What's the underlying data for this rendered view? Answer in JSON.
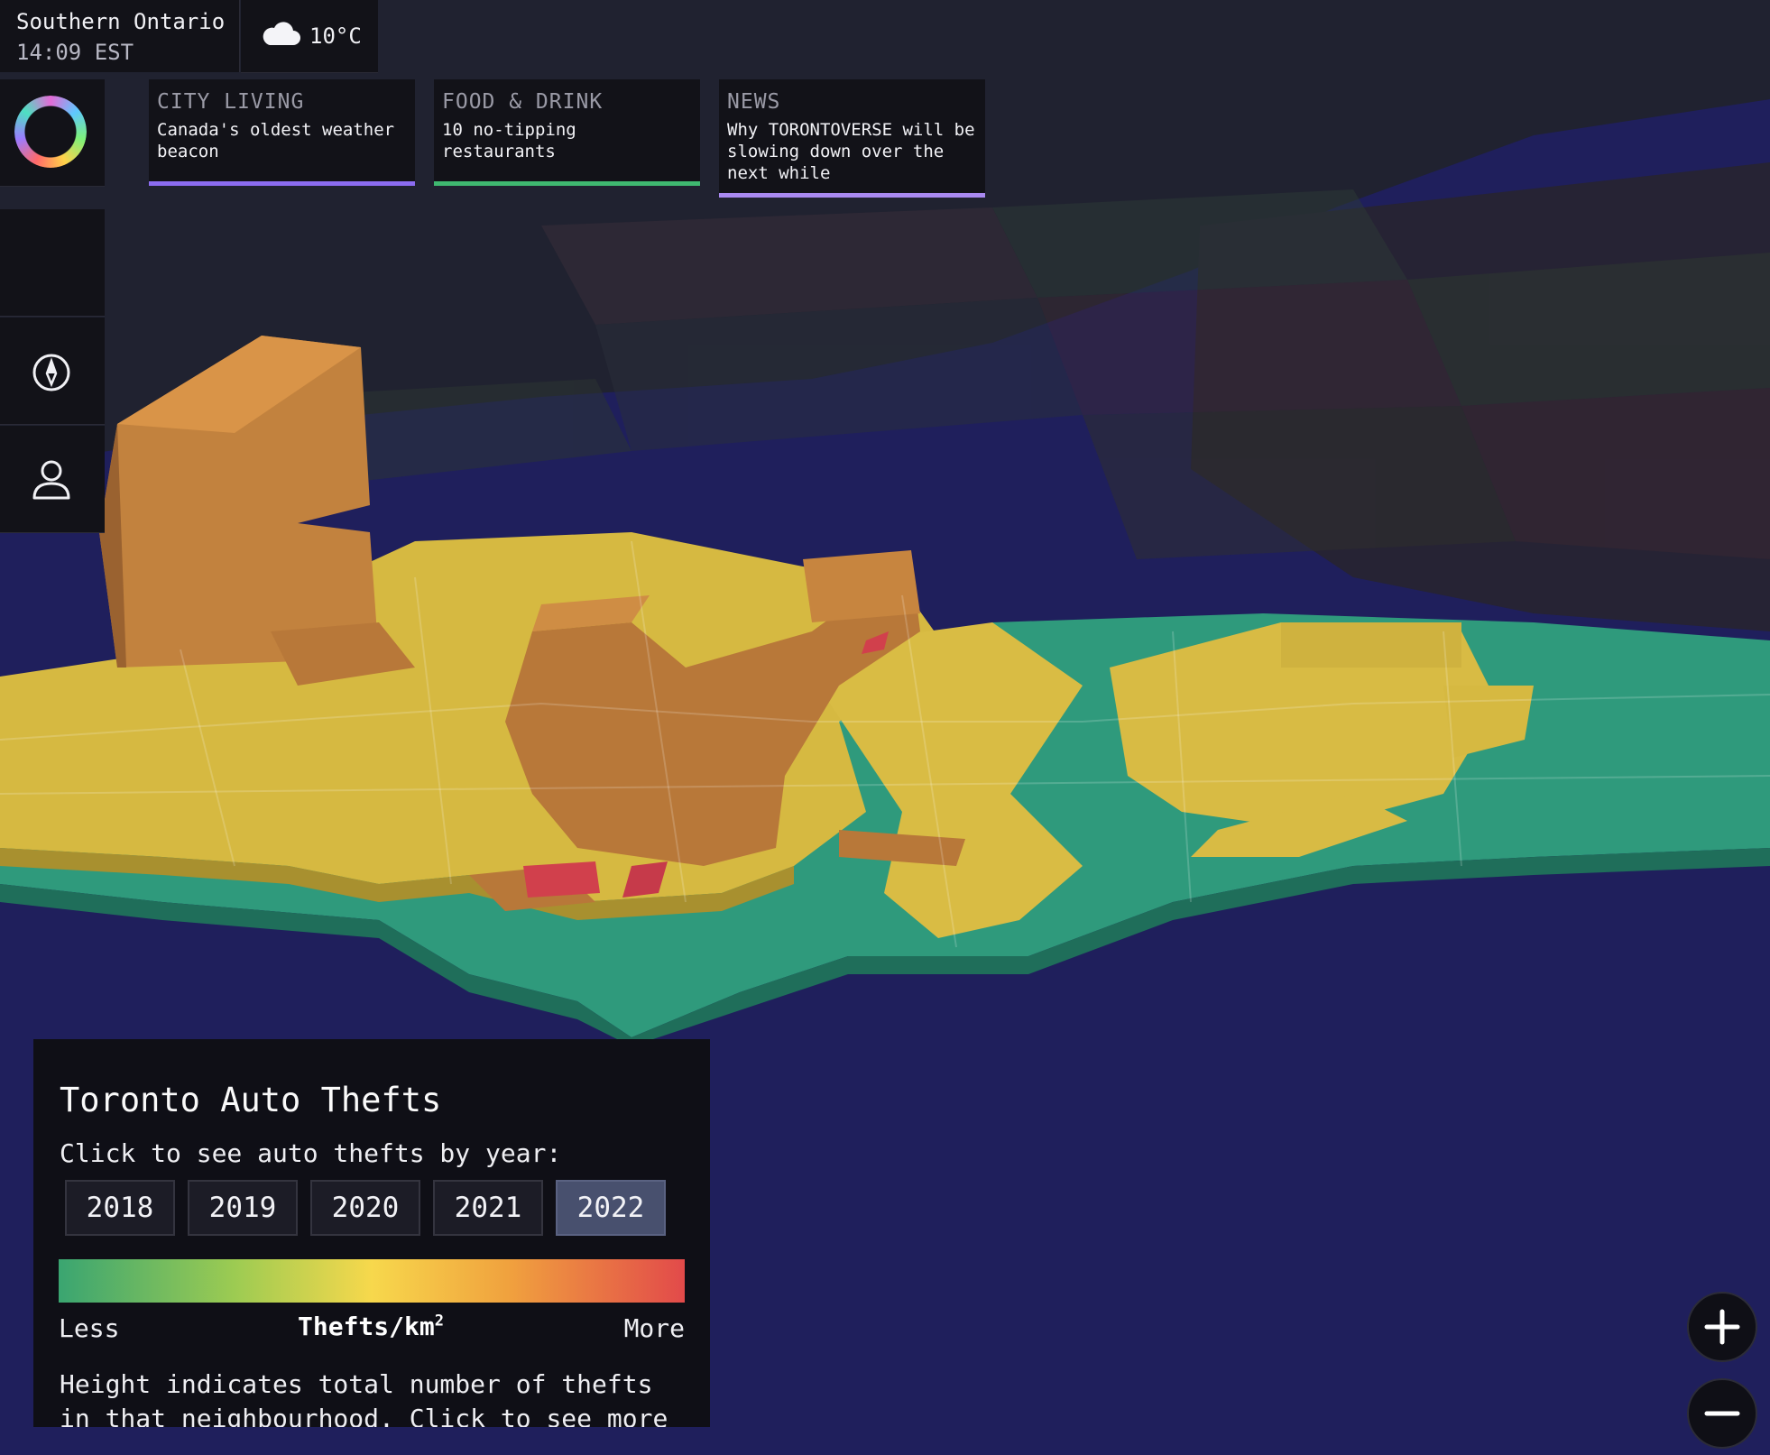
{
  "location": {
    "name": "Southern Ontario",
    "time": "14:09 EST"
  },
  "weather": {
    "icon": "cloud-icon",
    "temperature": "10°C"
  },
  "sidebar": {
    "logo": "logo-ring",
    "items": [
      {
        "icon": "blank"
      },
      {
        "icon": "compass-icon"
      },
      {
        "icon": "user-icon"
      }
    ]
  },
  "news": [
    {
      "category": "CITY LIVING",
      "title": "Canada's oldest weather beacon",
      "accent": "#8b6cf0"
    },
    {
      "category": "FOOD & DRINK",
      "title": "10 no-tipping restaurants",
      "accent": "#3fb870"
    },
    {
      "category": "NEWS",
      "title": "Why TORONTOVERSE will be slowing down over the next while",
      "accent": "#a989f0"
    }
  ],
  "legend": {
    "title": "Toronto Auto Thefts",
    "prompt": "Click to see auto thefts by year:",
    "years": [
      "2018",
      "2019",
      "2020",
      "2021",
      "2022"
    ],
    "selected_year": "2022",
    "less": "Less",
    "unit": "Thefts/km",
    "unit_sup": "2",
    "more": "More",
    "description": "Height indicates total number of thefts in that neighbourhood. Click to see more",
    "colors": {
      "low": "#3aa571",
      "mid": "#f7d84c",
      "high": "#e24a4a"
    }
  },
  "zoom": {
    "in": "+",
    "out": "−"
  },
  "colors": {
    "water": "#1f1f5c",
    "panel": "#121218"
  }
}
